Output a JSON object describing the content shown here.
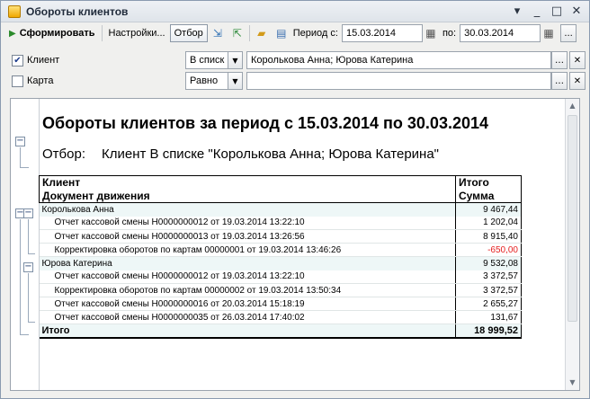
{
  "window": {
    "title": "Обороты клиентов",
    "controls": [
      "▾",
      "_",
      "□",
      "✕"
    ]
  },
  "toolbar": {
    "generate_label": "Сформировать",
    "settings_label": "Настройки...",
    "filter_label": "Отбор",
    "period_from_label": "Период с:",
    "period_from": "15.03.2014",
    "period_to_label": "по:",
    "period_to": "30.03.2014",
    "more_label": "..."
  },
  "filters": [
    {
      "checked": true,
      "label": "Клиент",
      "condition": "В списк",
      "value": "Королькова Анна; Юрова Катерина"
    },
    {
      "checked": false,
      "label": "Карта",
      "condition": "Равно",
      "value": ""
    }
  ],
  "report": {
    "title": "Обороты клиентов за период с 15.03.2014 по 30.03.2014",
    "filter_caption": "Отбор:",
    "filter_text": "Клиент В списке \"Королькова Анна; Юрова Катерина\"",
    "header": {
      "col1_top": "Клиент",
      "col2_top": "Итого",
      "col1_bottom": "Документ движения",
      "col2_bottom": "Сумма"
    },
    "groups": [
      {
        "name": "Королькова Анна",
        "total": "9 467,44",
        "rows": [
          {
            "doc": "Отчет кассовой смены Н0000000012 от 19.03.2014 13:22:10",
            "sum": "1 202,04",
            "negative": false
          },
          {
            "doc": "Отчет кассовой смены Н0000000013 от 19.03.2014 13:26:56",
            "sum": "8 915,40",
            "negative": false
          },
          {
            "doc": "Корректировка оборотов по картам 00000001 от 19.03.2014 13:46:26",
            "sum": "-650,00",
            "negative": true
          }
        ]
      },
      {
        "name": "Юрова Катерина",
        "total": "9 532,08",
        "rows": [
          {
            "doc": "Отчет кассовой смены Н0000000012 от 19.03.2014 13:22:10",
            "sum": "3 372,57",
            "negative": false
          },
          {
            "doc": "Корректировка оборотов по картам 00000002 от 19.03.2014 13:50:34",
            "sum": "3 372,57",
            "negative": false
          },
          {
            "doc": "Отчет кассовой смены Н0000000016 от 20.03.2014 15:18:19",
            "sum": "2 655,27",
            "negative": false
          },
          {
            "doc": "Отчет кассовой смены Н0000000035 от 26.03.2014 17:40:02",
            "sum": "131,67",
            "negative": false
          }
        ]
      }
    ],
    "grand_total_label": "Итого",
    "grand_total": "18 999,52"
  }
}
